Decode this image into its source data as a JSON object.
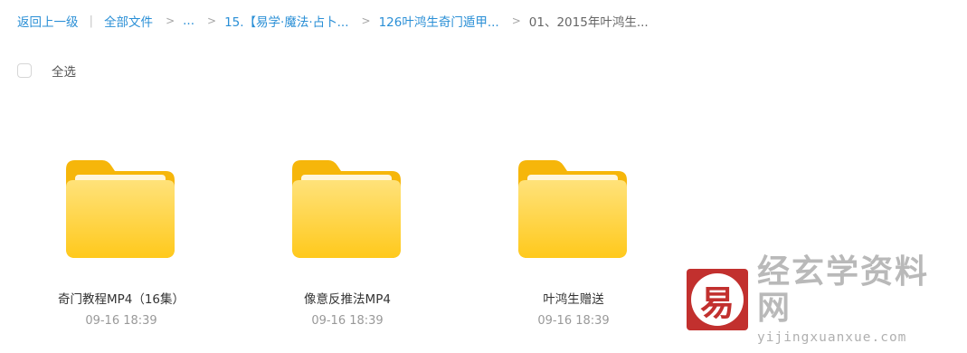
{
  "breadcrumb": {
    "back_label": "返回上一级",
    "divider": "|",
    "separator": ">",
    "crumbs": [
      "全部文件",
      "...",
      "15.【易学·魔法·占卜...",
      "126叶鸿生奇门遁甲..."
    ],
    "current": "01、2015年叶鸿生..."
  },
  "select_all": {
    "label": "全选"
  },
  "files": [
    {
      "name": "奇门教程MP4（16集）",
      "date": "09-16 18:39",
      "icon": "folder-icon"
    },
    {
      "name": "像意反推法MP4",
      "date": "09-16 18:39",
      "icon": "folder-icon"
    },
    {
      "name": "叶鸿生赠送",
      "date": "09-16 18:39",
      "icon": "folder-icon"
    }
  ],
  "watermark": {
    "logo_char": "易",
    "title": "经玄学资料网",
    "url": "yijingxuanxue.com"
  },
  "colors": {
    "link": "#2a8fd6",
    "folder_front": "#ffd54a",
    "folder_back": "#f6b60a",
    "watermark_red": "#c2302e"
  }
}
